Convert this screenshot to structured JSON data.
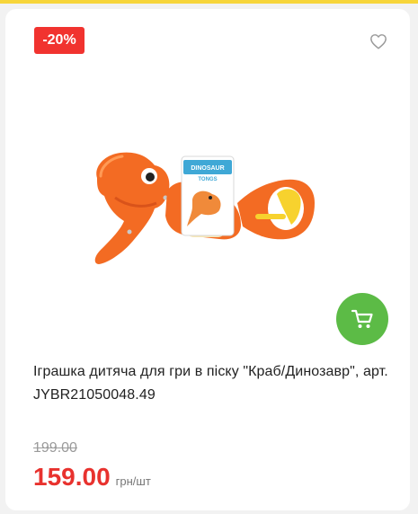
{
  "product": {
    "discount_badge": "-20%",
    "title": "Іграшка дитяча для гри в піску \"Краб/Динозавр\", арт. JYBR21050048.49",
    "old_price": "199.00",
    "price": "159.00",
    "unit": "грн/шт",
    "image_label_line1": "DINOSAUR",
    "image_label_line2": "TONGS"
  },
  "icons": {
    "favorite": "heart-outline-icon",
    "cart": "shopping-cart-icon"
  },
  "colors": {
    "badge": "#f1332f",
    "cart_button": "#5cbb46",
    "price": "#e8322e",
    "top_stripe": "#f7d53a"
  }
}
